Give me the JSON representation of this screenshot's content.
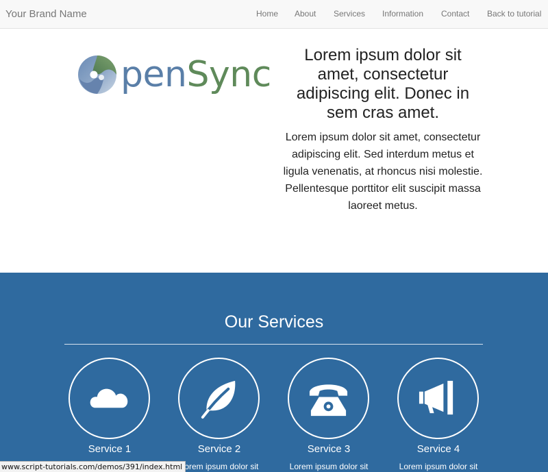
{
  "navbar": {
    "brand": "Your Brand Name",
    "links": [
      "Home",
      "About",
      "Services",
      "Information",
      "Contact",
      "Back to tutorial"
    ]
  },
  "hero": {
    "logo_text_part1": "penSync",
    "heading": "Lorem ipsum dolor sit amet, consectetur adipiscing elit. Donec in sem cras amet.",
    "paragraph": "Lorem ipsum dolor sit amet, consectetur adipiscing elit. Sed interdum metus et ligula venenatis, at rhoncus nisi molestie. Pellentesque porttitor elit suscipit massa laoreet metus."
  },
  "services": {
    "title": "Our Services",
    "items": [
      {
        "name": "Service 1",
        "icon": "cloud-icon",
        "desc": ""
      },
      {
        "name": "Service 2",
        "icon": "leaf-icon",
        "desc": "Lorem ipsum dolor sit"
      },
      {
        "name": "Service 3",
        "icon": "phone-icon",
        "desc": "Lorem ipsum dolor sit"
      },
      {
        "name": "Service 4",
        "icon": "megaphone-icon",
        "desc": "Lorem ipsum dolor sit"
      }
    ]
  },
  "status_bar": {
    "url": "www.script-tutorials.com/demos/391/index.html"
  },
  "colors": {
    "navbar_bg": "#f8f8f8",
    "services_bg": "#2f6a9f",
    "logo_blue": "#5a7fa8",
    "logo_green": "#5f8a5a"
  }
}
